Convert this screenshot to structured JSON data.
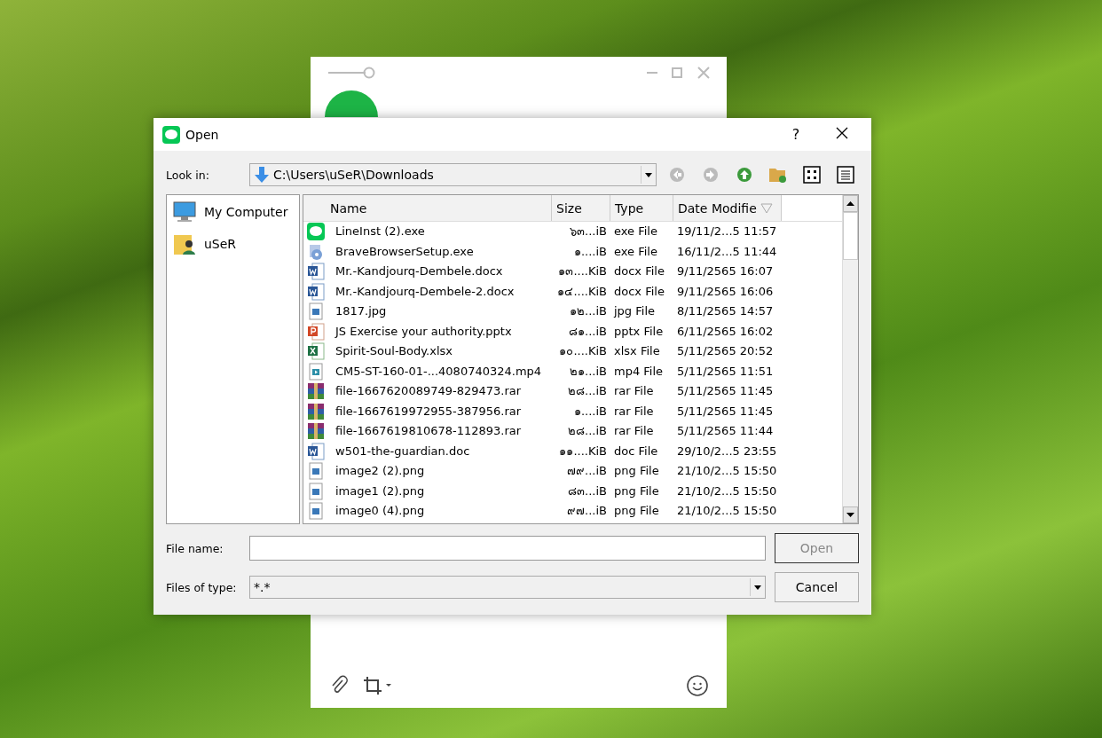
{
  "dialog": {
    "title": "Open",
    "help": "?",
    "look_in": {
      "label": "Look in:",
      "value": "C:\\Users\\uSeR\\Downloads"
    },
    "places": [
      {
        "label": "My Computer",
        "kind": "computer",
        "selected": false
      },
      {
        "label": "uSeR",
        "kind": "user",
        "selected": false
      }
    ],
    "columns": [
      {
        "label": "Name",
        "sorted": false
      },
      {
        "label": "Size",
        "sorted": false
      },
      {
        "label": "Type",
        "sorted": false
      },
      {
        "label": "Date Modifie",
        "sorted": true
      }
    ],
    "files": [
      {
        "name": "LineInst (2).exe",
        "size": "๖๓...iB",
        "type": "exe File",
        "date": "19/11/2...5 11:57",
        "kind": "line"
      },
      {
        "name": "BraveBrowserSetup.exe",
        "size": "๑....iB",
        "type": "exe File",
        "date": "16/11/2...5 11:44",
        "kind": "setup"
      },
      {
        "name": "Mr.-Kandjourq-Dembele.docx",
        "size": "๑๓....KiB",
        "type": "docx File",
        "date": "9/11/2565 16:07",
        "kind": "word"
      },
      {
        "name": "Mr.-Kandjourq-Dembele-2.docx",
        "size": "๑๔....KiB",
        "type": "docx File",
        "date": "9/11/2565 16:06",
        "kind": "word"
      },
      {
        "name": "1817.jpg",
        "size": "๑๒...iB",
        "type": "jpg File",
        "date": "8/11/2565 14:57",
        "kind": "image"
      },
      {
        "name": "JS Exercise your authority.pptx",
        "size": "๘๑...iB",
        "type": "pptx File",
        "date": "6/11/2565 16:02",
        "kind": "slides"
      },
      {
        "name": "Spirit-Soul-Body.xlsx",
        "size": "๑๐....KiB",
        "type": "xlsx File",
        "date": "5/11/2565 20:52",
        "kind": "sheet"
      },
      {
        "name": "CM5-ST-160-01-...4080740324.mp4",
        "size": "๒๑...iB",
        "type": "mp4 File",
        "date": "5/11/2565 11:51",
        "kind": "video"
      },
      {
        "name": "file-1667620089749-829473.rar",
        "size": "๒๘...iB",
        "type": "rar File",
        "date": "5/11/2565 11:45",
        "kind": "archive"
      },
      {
        "name": "file-1667619972955-387956.rar",
        "size": "๑....iB",
        "type": "rar File",
        "date": "5/11/2565 11:45",
        "kind": "archive"
      },
      {
        "name": "file-1667619810678-112893.rar",
        "size": "๒๘...iB",
        "type": "rar File",
        "date": "5/11/2565 11:44",
        "kind": "archive"
      },
      {
        "name": "w501-the-guardian.doc",
        "size": "๑๑....KiB",
        "type": "doc File",
        "date": "29/10/2...5 23:55",
        "kind": "word"
      },
      {
        "name": "image2 (2).png",
        "size": "๗๙...iB",
        "type": "png File",
        "date": "21/10/2...5 15:50",
        "kind": "image"
      },
      {
        "name": "image1 (2).png",
        "size": "๘๓...iB",
        "type": "png File",
        "date": "21/10/2...5 15:50",
        "kind": "image"
      },
      {
        "name": "image0 (4).png",
        "size": "๙๗...iB",
        "type": "png File",
        "date": "21/10/2...5 15:50",
        "kind": "image"
      }
    ],
    "file_name": {
      "label": "File name:"
    },
    "file_type": {
      "label": "Files of type:",
      "value": "*.*"
    },
    "buttons": [
      {
        "label": "Open",
        "disabled": true
      },
      {
        "label": "Cancel",
        "disabled": false
      }
    ]
  }
}
